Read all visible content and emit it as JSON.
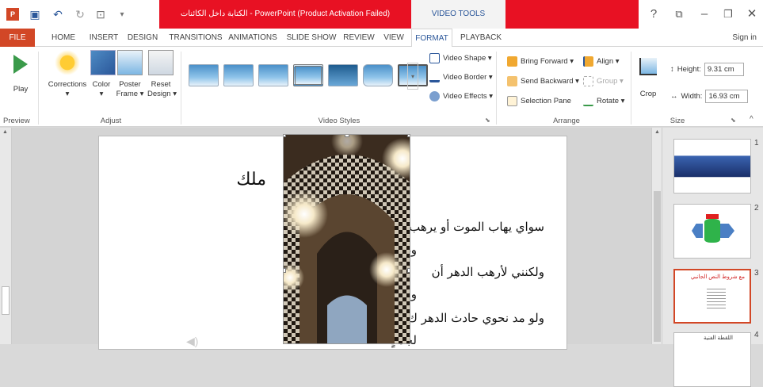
{
  "titlebar": {
    "title": "الكتابة داخل الكائنات - PowerPoint (Product Activation Failed)",
    "tools_label": "VIDEO TOOLS"
  },
  "tabs": [
    "FILE",
    "HOME",
    "INSERT",
    "DESIGN",
    "TRANSITIONS",
    "ANIMATIONS",
    "SLIDE SHOW",
    "REVIEW",
    "VIEW",
    "FORMAT",
    "PLAYBACK"
  ],
  "active_tab": "FORMAT",
  "signin": "Sign in",
  "ribbon": {
    "preview": {
      "play": "Play",
      "label": "Preview"
    },
    "adjust": {
      "corrections": "Corrections",
      "color": "Color",
      "poster_frame": "Poster\nFrame ▾",
      "reset_design": "Reset\nDesign ▾",
      "label": "Adjust"
    },
    "video_styles": {
      "label": "Video Styles",
      "shape": "Video Shape ▾",
      "border": "Video Border ▾",
      "effects": "Video Effects ▾"
    },
    "arrange": {
      "bring_forward": "Bring Forward ▾",
      "send_backward": "Send Backward ▾",
      "selection_pane": "Selection Pane",
      "align": "Align ▾",
      "group": "Group ▾",
      "rotate": "Rotate ▾",
      "label": "Arrange"
    },
    "size": {
      "crop": "Crop",
      "height_label": "Height:",
      "height_value": "9.31 cm",
      "width_label": "Width:",
      "width_value": "16.93 cm",
      "label": "Size"
    }
  },
  "slide": {
    "title_fragment": "ملك",
    "lines": [
      "سواي يهاب الموت أو يرهب",
      "وغير",
      "ولكنني لأرهب الدهر أن",
      "ولا أ",
      "ولو مد نحوي حادث الدهر ك",
      "لجذتٍ"
    ]
  },
  "thumbnails": [
    {
      "num": "1"
    },
    {
      "num": "2"
    },
    {
      "num": "3",
      "title": "مع شروط النص الجانبي"
    },
    {
      "num": "4",
      "title": "اللقطة الفنية"
    }
  ]
}
